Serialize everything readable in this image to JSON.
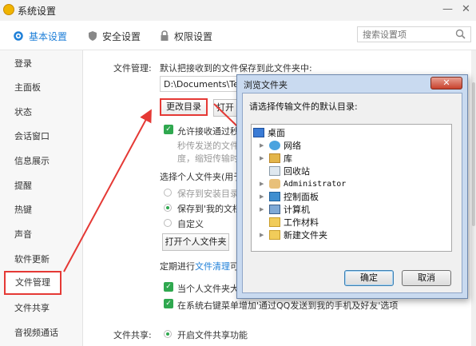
{
  "window": {
    "title": "系统设置",
    "minimize": "—",
    "close": "✕"
  },
  "tabs": [
    {
      "label": "基本设置",
      "icon": "gear-icon"
    },
    {
      "label": "安全设置",
      "icon": "shield-icon"
    },
    {
      "label": "权限设置",
      "icon": "lock-icon"
    }
  ],
  "search": {
    "placeholder": "搜索设置项"
  },
  "sidebar": {
    "items": [
      "登录",
      "主面板",
      "状态",
      "会话窗口",
      "信息展示",
      "提醒",
      "热键",
      "声音",
      "软件更新",
      "文件管理",
      "文件共享",
      "音视频通话"
    ],
    "active_index": 9
  },
  "file_mgmt": {
    "section_label": "文件管理:",
    "desc": "默认把接收到的文件保存到此文件夹中:",
    "path": "D:\\Documents\\Ten",
    "change_dir": "更改目录",
    "open": "打开",
    "allow_auto": "允许接收通过秒",
    "hint1": "秒传发送的文件",
    "hint2": "度，缩短传输时",
    "personal_title": "选择个人文件夹(用于",
    "radio1": "保存到安装目录",
    "radio2": "保存到'我的文档",
    "radio3": "自定义",
    "open_personal": "打开个人文件夹",
    "cleanup_prefix": "定期进行",
    "cleanup_link": "文件清理",
    "cleanup_suffix": "可",
    "check2": "当个人文件夹大",
    "check3": "在系统右键菜单增加'通过QQ发送到我的手机及好友'选项"
  },
  "file_share": {
    "section_label": "文件共享:",
    "enable": "开启文件共享功能"
  },
  "dialog": {
    "title": "浏览文件夹",
    "close": "✕",
    "prompt": "请选择传输文件的默认目录:",
    "tree": [
      "桌面",
      "网络",
      "库",
      "回收站",
      "Administrator",
      "控制面板",
      "计算机",
      "工作材料",
      "新建文件夹"
    ],
    "ok": "确定",
    "cancel": "取消"
  },
  "colors": {
    "accent": "#1e7fd8",
    "annotation": "#e53935",
    "check": "#2fa84f"
  }
}
